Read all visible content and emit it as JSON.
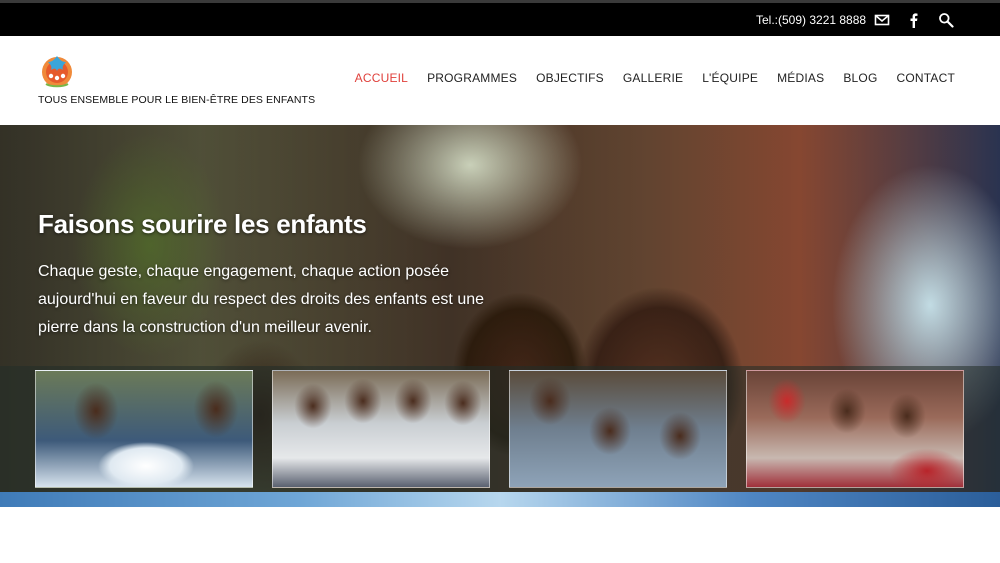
{
  "topbar": {
    "phone": "Tel.:(509) 3221 8888",
    "icons": [
      "email-icon",
      "facebook-icon",
      "search-icon"
    ]
  },
  "header": {
    "logo": "logo-icon",
    "tagline": "TOUS ENSEMBLE POUR LE BIEN-ÊTRE DES ENFANTS"
  },
  "nav": {
    "items": [
      {
        "label": "ACCUEIL",
        "active": true
      },
      {
        "label": "PROGRAMMES"
      },
      {
        "label": "OBJECTIFS"
      },
      {
        "label": "GALLERIE"
      },
      {
        "label": "L'ÉQUIPE"
      },
      {
        "label": "MÉDIAS"
      },
      {
        "label": "BLOG"
      },
      {
        "label": "CONTACT"
      }
    ]
  },
  "hero": {
    "title": "Faisons sourire les enfants",
    "text": "Chaque geste, chaque engagement, chaque action posée aujourd'hui en faveur du respect des droits des enfants est une pierre dans la construction d'un meilleur avenir."
  },
  "colors": {
    "accent": "#e0403b",
    "topbar": "#000000"
  }
}
